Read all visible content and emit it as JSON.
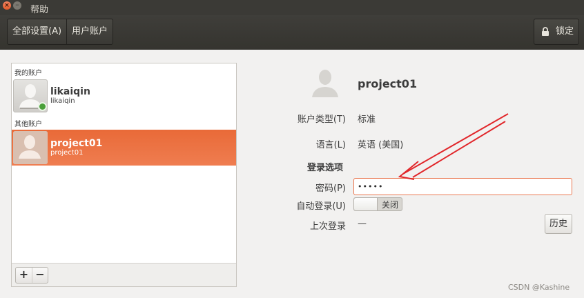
{
  "window": {
    "title": "帮助",
    "close_glyph": "×",
    "minimize_glyph": "–"
  },
  "toolbar": {
    "all_settings": "全部设置(A)",
    "user_accounts": "用户账户",
    "lock_label": "锁定",
    "lock_icon": "lock-icon"
  },
  "accounts": {
    "my_section": "我的账户",
    "other_section": "其他账户",
    "users": [
      {
        "name": "likaiqin",
        "login": "likaiqin",
        "status": "online",
        "status_color": "#4aa03a"
      },
      {
        "name": "project01",
        "login": "project01",
        "selected_color": "#ec7448"
      }
    ],
    "add_glyph": "+",
    "remove_glyph": "−"
  },
  "details": {
    "name": "project01",
    "account_type_label": "账户类型(T)",
    "account_type_value": "标准",
    "language_label": "语言(L)",
    "language_value": "英语 (美国)",
    "login_options_title": "登录选项",
    "password_label": "密码(P)",
    "password_value": "•••••",
    "autologin_label": "自动登录(U)",
    "autologin_state": "关闭",
    "last_login_label": "上次登录",
    "last_login_value": "—",
    "history_button": "历史"
  },
  "annotation": {
    "arrow_color": "#e1262a"
  },
  "watermark": "CSDN @Kashine"
}
